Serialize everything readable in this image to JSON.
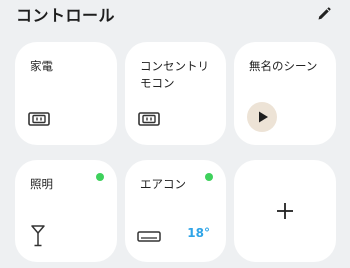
{
  "header": {
    "title": "コントロール"
  },
  "cards": [
    {
      "label": "家電",
      "icon": "outlet-icon"
    },
    {
      "label": "コンセントリ\nモコン",
      "icon": "outlet-icon"
    },
    {
      "label": "無名のシーン",
      "icon": "play-icon"
    },
    {
      "label": "照明",
      "icon": "lamp-icon",
      "status": "on"
    },
    {
      "label": "エアコン",
      "icon": "air-conditioner-icon",
      "status": "on",
      "temperature": "18°"
    },
    {
      "icon": "plus-icon"
    }
  ],
  "colors": {
    "background": "#eef0f2",
    "card": "#ffffff",
    "status_on": "#3ed15c",
    "temperature": "#2fa4e7",
    "play_bg": "#ede3d6"
  }
}
